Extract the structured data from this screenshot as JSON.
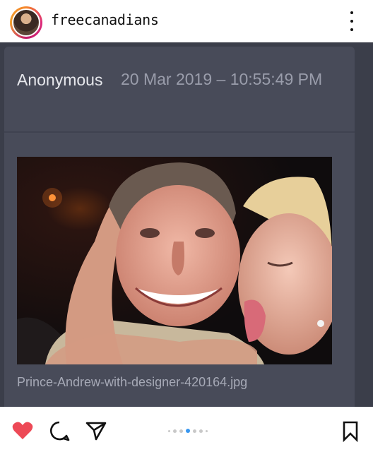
{
  "header": {
    "username": "freecanadians",
    "avatar_icon": "profile-avatar",
    "more_icon": "more-vertical-icon"
  },
  "post": {
    "author": "Anonymous",
    "timestamp": "20 Mar 2019 – 10:55:49 PM",
    "image_filename": "Prince-Andrew-with-designer-420164.jpg",
    "colors": {
      "background": "#3b3e4a",
      "card": "#484b59",
      "author_text": "#e6e7ec",
      "date_text": "#9a9dab"
    }
  },
  "actions": {
    "like_icon": "heart-filled-icon",
    "like_color": "#ed4956",
    "comment_icon": "comment-icon",
    "share_icon": "send-icon",
    "save_icon": "bookmark-icon",
    "carousel": {
      "total": 7,
      "active_index": 3,
      "active_color": "#3897f0"
    }
  }
}
